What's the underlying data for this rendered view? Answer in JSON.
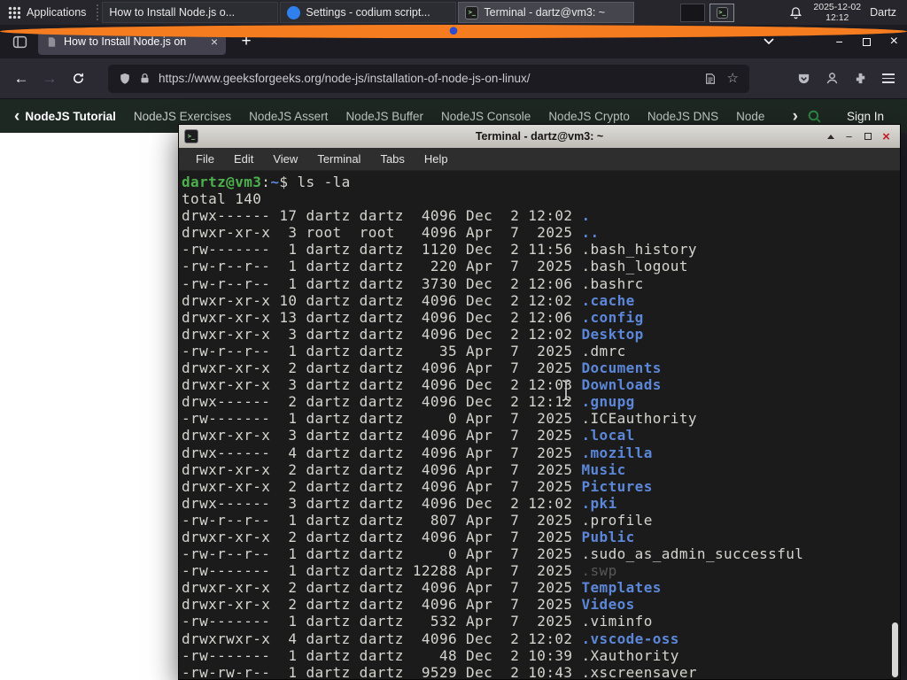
{
  "colors": {
    "gfg_green": "#2f8d46",
    "dir_blue": "#5c87d9",
    "prompt_green": "#4cb04c",
    "close_red": "#c01c28"
  },
  "panel": {
    "applications_label": "Applications",
    "tasks": [
      {
        "icon": "firefox",
        "label": "How to Install Node.js o..."
      },
      {
        "icon": "codium",
        "label": "Settings - codium script..."
      },
      {
        "icon": "terminal",
        "label": "Terminal - dartz@vm3: ~",
        "active": true
      }
    ],
    "clock_date": "2025-12-02",
    "clock_time": "12:12",
    "user_label": "Dartz"
  },
  "browser": {
    "tab_title": "How to Install Node.js on",
    "new_tab_label": "+",
    "url": "https://www.geeksforgeeks.org/node-js/installation-of-node-js-on-linux/"
  },
  "site_nav": {
    "items": [
      "NodeJS Tutorial",
      "NodeJS Exercises",
      "NodeJS Assert",
      "NodeJS Buffer",
      "NodeJS Console",
      "NodeJS Crypto",
      "NodeJS DNS",
      "Node"
    ],
    "sign_in_label": "Sign In"
  },
  "terminal": {
    "title": "Terminal - dartz@vm3: ~",
    "menu": [
      "File",
      "Edit",
      "View",
      "Terminal",
      "Tabs",
      "Help"
    ],
    "prompt_user_host": "dartz@vm3",
    "prompt_separator": ":",
    "prompt_path": "~",
    "prompt_symbol": "$",
    "command": "ls -la",
    "total_line": "total 140",
    "listing": [
      {
        "meta": "drwx------ 17 dartz dartz  4096 Dec  2 12:02 ",
        "name": ".",
        "type": "dir"
      },
      {
        "meta": "drwxr-xr-x  3 root  root   4096 Apr  7  2025 ",
        "name": "..",
        "type": "dir"
      },
      {
        "meta": "-rw-------  1 dartz dartz  1120 Dec  2 11:56 ",
        "name": ".bash_history",
        "type": "file"
      },
      {
        "meta": "-rw-r--r--  1 dartz dartz   220 Apr  7  2025 ",
        "name": ".bash_logout",
        "type": "file"
      },
      {
        "meta": "-rw-r--r--  1 dartz dartz  3730 Dec  2 12:06 ",
        "name": ".bashrc",
        "type": "file"
      },
      {
        "meta": "drwxr-xr-x 10 dartz dartz  4096 Dec  2 12:02 ",
        "name": ".cache",
        "type": "dir"
      },
      {
        "meta": "drwxr-xr-x 13 dartz dartz  4096 Dec  2 12:06 ",
        "name": ".config",
        "type": "dir"
      },
      {
        "meta": "drwxr-xr-x  3 dartz dartz  4096 Dec  2 12:02 ",
        "name": "Desktop",
        "type": "dir"
      },
      {
        "meta": "-rw-r--r--  1 dartz dartz    35 Apr  7  2025 ",
        "name": ".dmrc",
        "type": "file"
      },
      {
        "meta": "drwxr-xr-x  2 dartz dartz  4096 Apr  7  2025 ",
        "name": "Documents",
        "type": "dir"
      },
      {
        "meta": "drwxr-xr-x  3 dartz dartz  4096 Dec  2 12:03 ",
        "name": "Downloads",
        "type": "dir"
      },
      {
        "meta": "drwx------  2 dartz dartz  4096 Dec  2 12:12 ",
        "name": ".gnupg",
        "type": "dir"
      },
      {
        "meta": "-rw-------  1 dartz dartz     0 Apr  7  2025 ",
        "name": ".ICEauthority",
        "type": "file"
      },
      {
        "meta": "drwxr-xr-x  3 dartz dartz  4096 Apr  7  2025 ",
        "name": ".local",
        "type": "dir"
      },
      {
        "meta": "drwx------  4 dartz dartz  4096 Apr  7  2025 ",
        "name": ".mozilla",
        "type": "dir"
      },
      {
        "meta": "drwxr-xr-x  2 dartz dartz  4096 Apr  7  2025 ",
        "name": "Music",
        "type": "dir"
      },
      {
        "meta": "drwxr-xr-x  2 dartz dartz  4096 Apr  7  2025 ",
        "name": "Pictures",
        "type": "dir"
      },
      {
        "meta": "drwx------  3 dartz dartz  4096 Dec  2 12:02 ",
        "name": ".pki",
        "type": "dir"
      },
      {
        "meta": "-rw-r--r--  1 dartz dartz   807 Apr  7  2025 ",
        "name": ".profile",
        "type": "file"
      },
      {
        "meta": "drwxr-xr-x  2 dartz dartz  4096 Apr  7  2025 ",
        "name": "Public",
        "type": "dir"
      },
      {
        "meta": "-rw-r--r--  1 dartz dartz     0 Apr  7  2025 ",
        "name": ".sudo_as_admin_successful",
        "type": "file"
      },
      {
        "meta": "-rw-------  1 dartz dartz 12288 Apr  7  2025 ",
        "name": ".swp",
        "type": "dim"
      },
      {
        "meta": "drwxr-xr-x  2 dartz dartz  4096 Apr  7  2025 ",
        "name": "Templates",
        "type": "dir"
      },
      {
        "meta": "drwxr-xr-x  2 dartz dartz  4096 Apr  7  2025 ",
        "name": "Videos",
        "type": "dir"
      },
      {
        "meta": "-rw-------  1 dartz dartz   532 Apr  7  2025 ",
        "name": ".viminfo",
        "type": "file"
      },
      {
        "meta": "drwxrwxr-x  4 dartz dartz  4096 Dec  2 12:02 ",
        "name": ".vscode-oss",
        "type": "dir"
      },
      {
        "meta": "-rw-------  1 dartz dartz    48 Dec  2 10:39 ",
        "name": ".Xauthority",
        "type": "file"
      },
      {
        "meta": "-rw-rw-r--  1 dartz dartz  9529 Dec  2 10:43 ",
        "name": ".xscreensaver",
        "type": "file"
      }
    ]
  }
}
